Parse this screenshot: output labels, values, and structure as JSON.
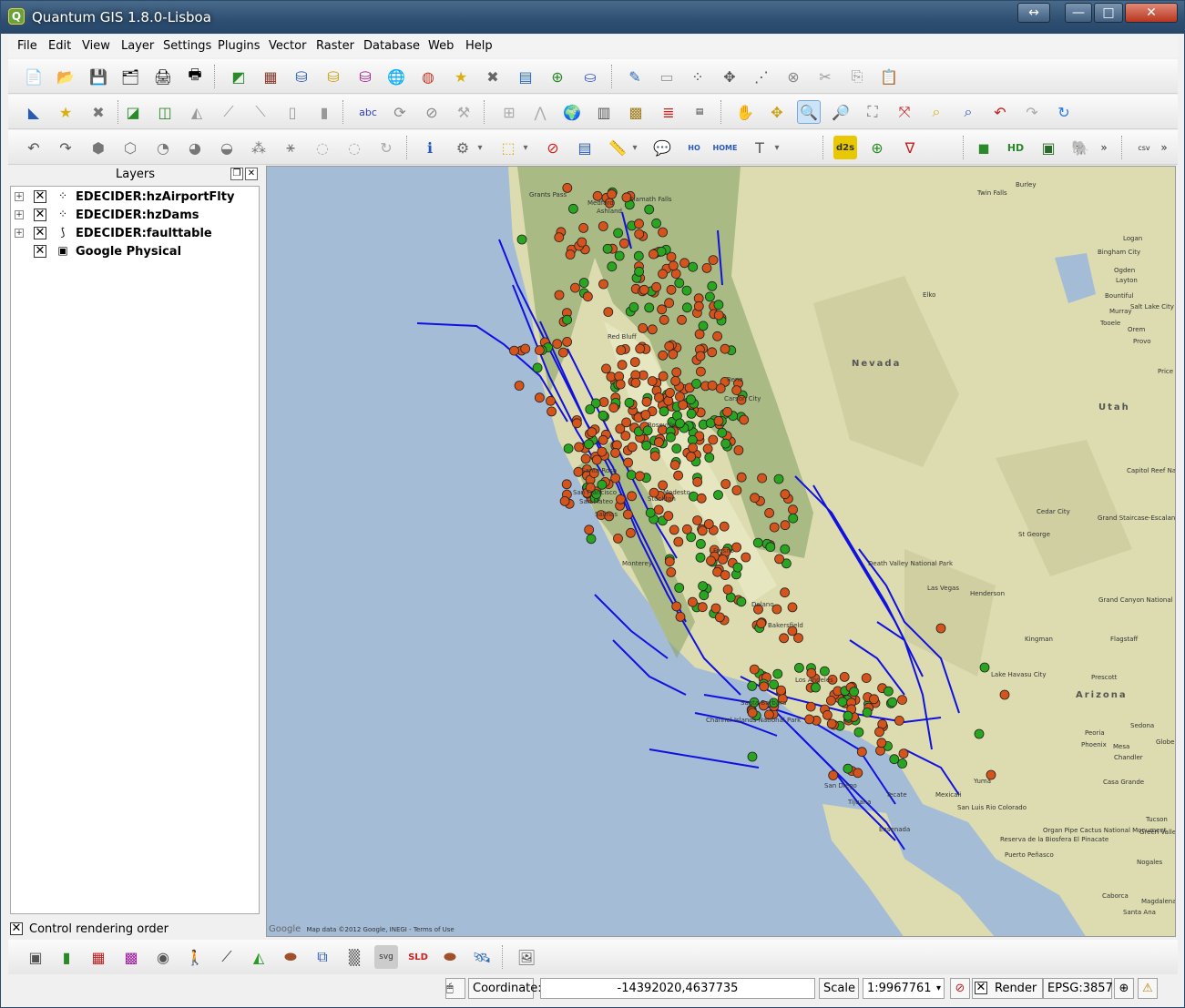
{
  "window": {
    "title": "Quantum GIS 1.8.0-Lisboa",
    "controls": {
      "restore_symbol": "↔",
      "minimize_symbol": "—",
      "maximize_symbol": "□",
      "close_symbol": "✕"
    }
  },
  "menubar": {
    "items": [
      "File",
      "Edit",
      "View",
      "Layer",
      "Settings",
      "Plugins",
      "Vector",
      "Raster",
      "Database",
      "Web",
      "Help"
    ]
  },
  "toolbar_icons": {
    "row1": [
      "new-project",
      "open-project",
      "save-project",
      "save-as",
      "print-composer",
      "print",
      "add-vector",
      "add-raster",
      "add-postgis",
      "add-spatialite",
      "add-mssql",
      "add-wms",
      "new-shapefile",
      "remove-layer",
      "new-spatialite",
      "add-wfs",
      "add-oracle",
      "toggle-editing",
      "save-edits",
      "add-feature",
      "move-feature",
      "node-tool",
      "delete-selected",
      "cut-features",
      "copy-features",
      "paste-features"
    ],
    "row2": [
      "add-vector-layer",
      "favorite",
      "remove",
      "digitize",
      "add-ring",
      "add-part",
      "simplify",
      "reshape",
      "split",
      "merge",
      "label",
      "rotate",
      "offset",
      "split-parts",
      "identify-chart",
      "histogram",
      "globe",
      "raster-calc",
      "terrain",
      "colormap",
      "legend-table",
      "pan",
      "pan-to-selection",
      "zoom-in",
      "zoom-out",
      "zoom-full",
      "zoom-layer",
      "zoom-selection",
      "zoom-native",
      "zoom-last",
      "zoom-next",
      "refresh"
    ],
    "row3": [
      "undo",
      "redo",
      "fill-ring",
      "delete-ring",
      "delete-part",
      "reshape-features",
      "offset-curve",
      "split-features",
      "rotate-point",
      "add-circle",
      "trace",
      "rotate-redo",
      "identify",
      "action",
      "select-features",
      "deselect",
      "attribute-table",
      "measure",
      "map-tips",
      "new-bookmark",
      "show-bookmarks",
      "text-annotation",
      "d2s",
      "add-layer-plus",
      "georef",
      "open-street-map",
      "hd",
      "photo",
      "elephant",
      "more",
      "csv"
    ],
    "d2s_label": "d2s",
    "hd_label": "HD",
    "csv_label": "csv",
    "home_label": "HOME",
    "bottom": [
      "qgis-composer",
      "green-book",
      "grid-color",
      "mosaic",
      "gear-globe",
      "walker",
      "line-nodes",
      "terrain-shade",
      "saucer",
      "overlay-squares",
      "raster-gray",
      "svg-tool",
      "sld",
      "saucer2",
      "satellite",
      "image-export"
    ],
    "svg_label": "svg",
    "sld_label": "SLD"
  },
  "layers_panel": {
    "title": "Layers",
    "layers": [
      {
        "name": "EDECIDER:hzAirportFlty",
        "checked": true,
        "icon": "points-icon",
        "expandable": true
      },
      {
        "name": "EDECIDER:hzDams",
        "checked": true,
        "icon": "points-icon",
        "expandable": true
      },
      {
        "name": "EDECIDER:faulttable",
        "checked": true,
        "icon": "lines-icon",
        "expandable": true
      },
      {
        "name": "Google Physical",
        "checked": true,
        "icon": "raster-icon",
        "expandable": false
      }
    ],
    "render_order_label": "Control rendering order",
    "render_order_checked": true
  },
  "map": {
    "states": [
      "Nevada",
      "Utah",
      "Arizona"
    ],
    "places": [
      "Grants Pass",
      "Medford",
      "Ashland",
      "Klamath Falls",
      "Burley",
      "Twin Falls",
      "Bingham City",
      "Ogden",
      "Layton",
      "Logan",
      "Bountiful",
      "Salt Lake City",
      "Murray",
      "Tooele",
      "Orem",
      "Provo",
      "Elko",
      "Price",
      "Red Bluff",
      "Reno",
      "Carson City",
      "Roseville",
      "Santa Rosa",
      "San Francisco",
      "San Mateo",
      "Stockton",
      "Modesto",
      "Fresno",
      "Monterey",
      "Salinas",
      "Delano",
      "Bakersfield",
      "Las Vegas",
      "Henderson",
      "St George",
      "Cedar City",
      "Death Valley National Park",
      "Grand Staircase-Escalante National Monument",
      "Grand Canyon National Park",
      "Flagstaff",
      "Kingman",
      "Lake Havasu City",
      "Prescott",
      "Peoria",
      "Phoenix",
      "Mesa",
      "Chandler",
      "Casa Grande",
      "Tucson",
      "Yuma",
      "San Luis Rio Colorado",
      "San Diego",
      "Tijuana",
      "Tecate",
      "Mexicali",
      "Ensenada",
      "Channel Islands National Park",
      "Santa Barbara",
      "Los Angeles",
      "Sedona",
      "Globe",
      "Green Valley",
      "Organ Pipe Cactus National Monument",
      "Puerto Peñasco",
      "Nogales",
      "Caborca",
      "Magdalena",
      "Santa Ana",
      "Capitol Reef National Park",
      "Reserva de la Biosfera El Pinacate"
    ],
    "attribution": "Map data ©2012 Google, INEGI - Terms of Use",
    "google_mark": "Google",
    "point_colors": {
      "airport": "#2aa520",
      "dam": "#d4541c",
      "fault": "#1010e0",
      "outline": "#222222"
    }
  },
  "statusbar": {
    "coordinate_label": "Coordinate:",
    "coordinate_value": "-14392020,4637735",
    "scale_label": "Scale",
    "scale_value": "1:9967761",
    "render_label": "Render",
    "render_checked": true,
    "crs": "EPSG:3857"
  }
}
